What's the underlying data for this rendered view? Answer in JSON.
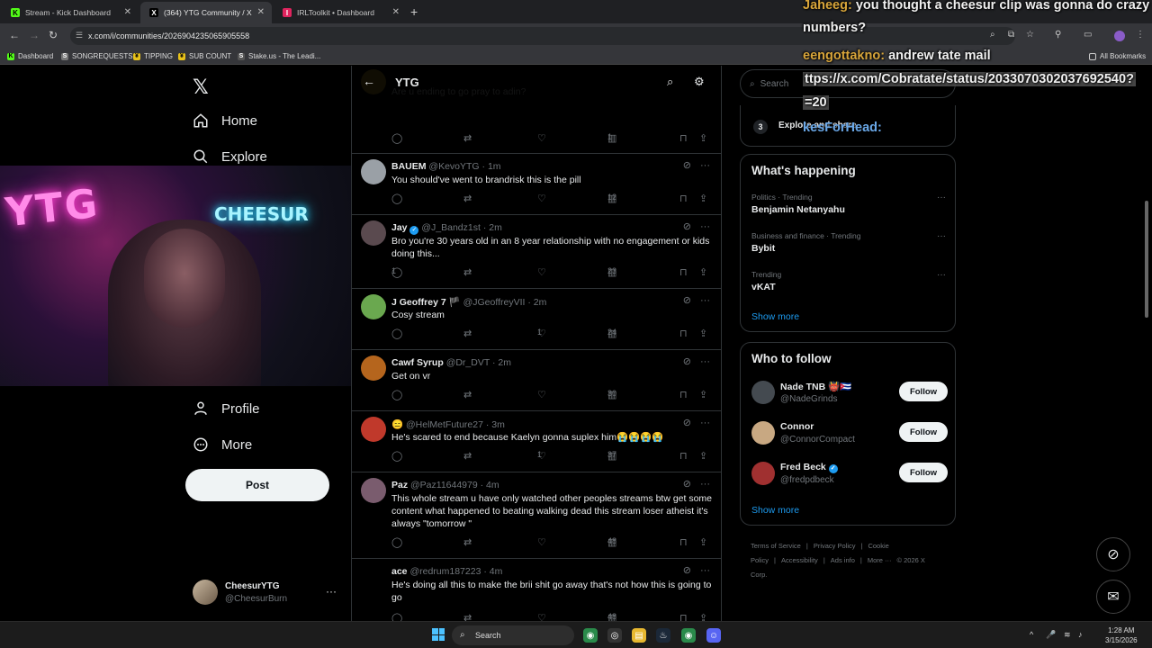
{
  "browser": {
    "tabs": [
      {
        "title": "Stream - Kick Dashboard",
        "favicon": "K"
      },
      {
        "title": "(364) YTG Community / X",
        "favicon": "X"
      },
      {
        "title": "IRLToolkit • Dashboard",
        "favicon": "I"
      }
    ],
    "url": "x.com/i/communities/2026904235065905558",
    "bookmarks": [
      "Dashboard",
      "SONGREQUESTS",
      "TIPPING",
      "SUB COUNT",
      "Stake.us - The Leadi..."
    ],
    "all_bookmarks": "All Bookmarks"
  },
  "nav": {
    "home": "Home",
    "explore": "Explore",
    "profile": "Profile",
    "more": "More",
    "post": "Post",
    "account_name": "CheesurYTG",
    "account_handle": "@CheesurBurn"
  },
  "webcam": {
    "sign_left": "YTG",
    "sign_right": "CHEESUR"
  },
  "timeline": {
    "title": "YTG",
    "posts": [
      {
        "name": "",
        "handle": "",
        "time": "",
        "text": "Are u ending to go pray to adin?",
        "replies": "",
        "likes": "",
        "views": "1",
        "avatar_color": "#c9a227"
      },
      {
        "name": "BAUEM",
        "handle": "@KevoYTG",
        "time": "· 1m",
        "text": "You should've went to brandrisk this is the pill",
        "replies": "",
        "likes": "",
        "views": "12",
        "avatar_color": "#9aa0a6"
      },
      {
        "name": "Jay",
        "handle": "@J_Bandz1st",
        "time": "· 2m",
        "text": "Bro you're 30 years old in an 8 year relationship with no engagement or kids doing this...",
        "replies": "1",
        "likes": "",
        "views": "23",
        "avatar_color": "#5a4a4f",
        "verified": true
      },
      {
        "name": "J Geoffrey 7 🏴",
        "handle": "@JGeoffreyVII",
        "time": "· 2m",
        "text": "Cosy stream",
        "replies": "",
        "likes": "1",
        "views": "24",
        "avatar_color": "#6aa84f"
      },
      {
        "name": "Cawf Syrup",
        "handle": "@Dr_DVT",
        "time": "· 2m",
        "text": "Get on vr",
        "replies": "",
        "likes": "",
        "views": "30",
        "avatar_color": "#b5651d"
      },
      {
        "name": "😑",
        "handle": "@HelMetFuture27",
        "time": "· 3m",
        "text": "He's scared to end because Kaelyn gonna  suplex him😭😭😭😭",
        "replies": "",
        "likes": "1",
        "views": "37",
        "avatar_color": "#c0392b"
      },
      {
        "name": "Paz",
        "handle": "@Paz11644979",
        "time": "· 4m",
        "text": "This whole stream u have only watched other peoples streams btw get some content what happened to beating walking dead this stream loser atheist it's always \"tomorrow \"",
        "replies": "",
        "likes": "",
        "views": "48",
        "avatar_color": "#7a5c6e"
      },
      {
        "name": "ace",
        "handle": "@redrum187223",
        "time": "· 4m",
        "text": "He's doing all this to make the brii shit go away that's not how this is going to go",
        "replies": "",
        "likes": "",
        "views": "48",
        "avatar_color": "#000000"
      }
    ]
  },
  "right": {
    "search_placeholder": "Search",
    "step_number": "3",
    "step_label": "Explore and share",
    "whats_happening": "What's happening",
    "trends": [
      {
        "category": "Politics · Trending",
        "name": "Benjamin Netanyahu"
      },
      {
        "category": "Business and finance · Trending",
        "name": "Bybit"
      },
      {
        "category": "Trending",
        "name": "vKAT"
      }
    ],
    "show_more": "Show more",
    "who_to_follow": "Who to follow",
    "follows": [
      {
        "name": "Nade TNB 👹🇨🇺",
        "handle": "@NadeGrinds",
        "button": "Follow",
        "avatar_color": "#444a50"
      },
      {
        "name": "Connor",
        "handle": "@ConnorCompact",
        "button": "Follow",
        "avatar_color": "#c8a882"
      },
      {
        "name": "Fred Beck",
        "handle": "@fredpdbeck",
        "button": "Follow",
        "avatar_color": "#a03030",
        "verified": true
      }
    ],
    "footer": [
      "Terms of Service",
      "|",
      "Privacy Policy",
      "|",
      "Cookie Policy",
      "|",
      "Accessibility",
      "|",
      "Ads info",
      "|",
      "More ···",
      "© 2026 X Corp."
    ]
  },
  "chat": [
    {
      "user": "Jaheeg:",
      "message": "you thought a cheesur clip was gonna do crazy"
    },
    {
      "user": "",
      "message": "numbers?"
    },
    {
      "user": "eengottakno:",
      "message": "andrew tate mail"
    },
    {
      "user": "",
      "message": "ttps://x.com/Cobratate/status/2033070302037692540?"
    },
    {
      "user": "",
      "message": "=20"
    },
    {
      "user": "kesForHead:",
      "message": ""
    }
  ],
  "taskbar": {
    "search": "Search",
    "time": "1:28 AM",
    "date": "3/15/2026"
  },
  "colors": {
    "accent": "#1d9bf0",
    "background": "#000000",
    "text": "#e7e9ea",
    "muted": "#71767b"
  }
}
